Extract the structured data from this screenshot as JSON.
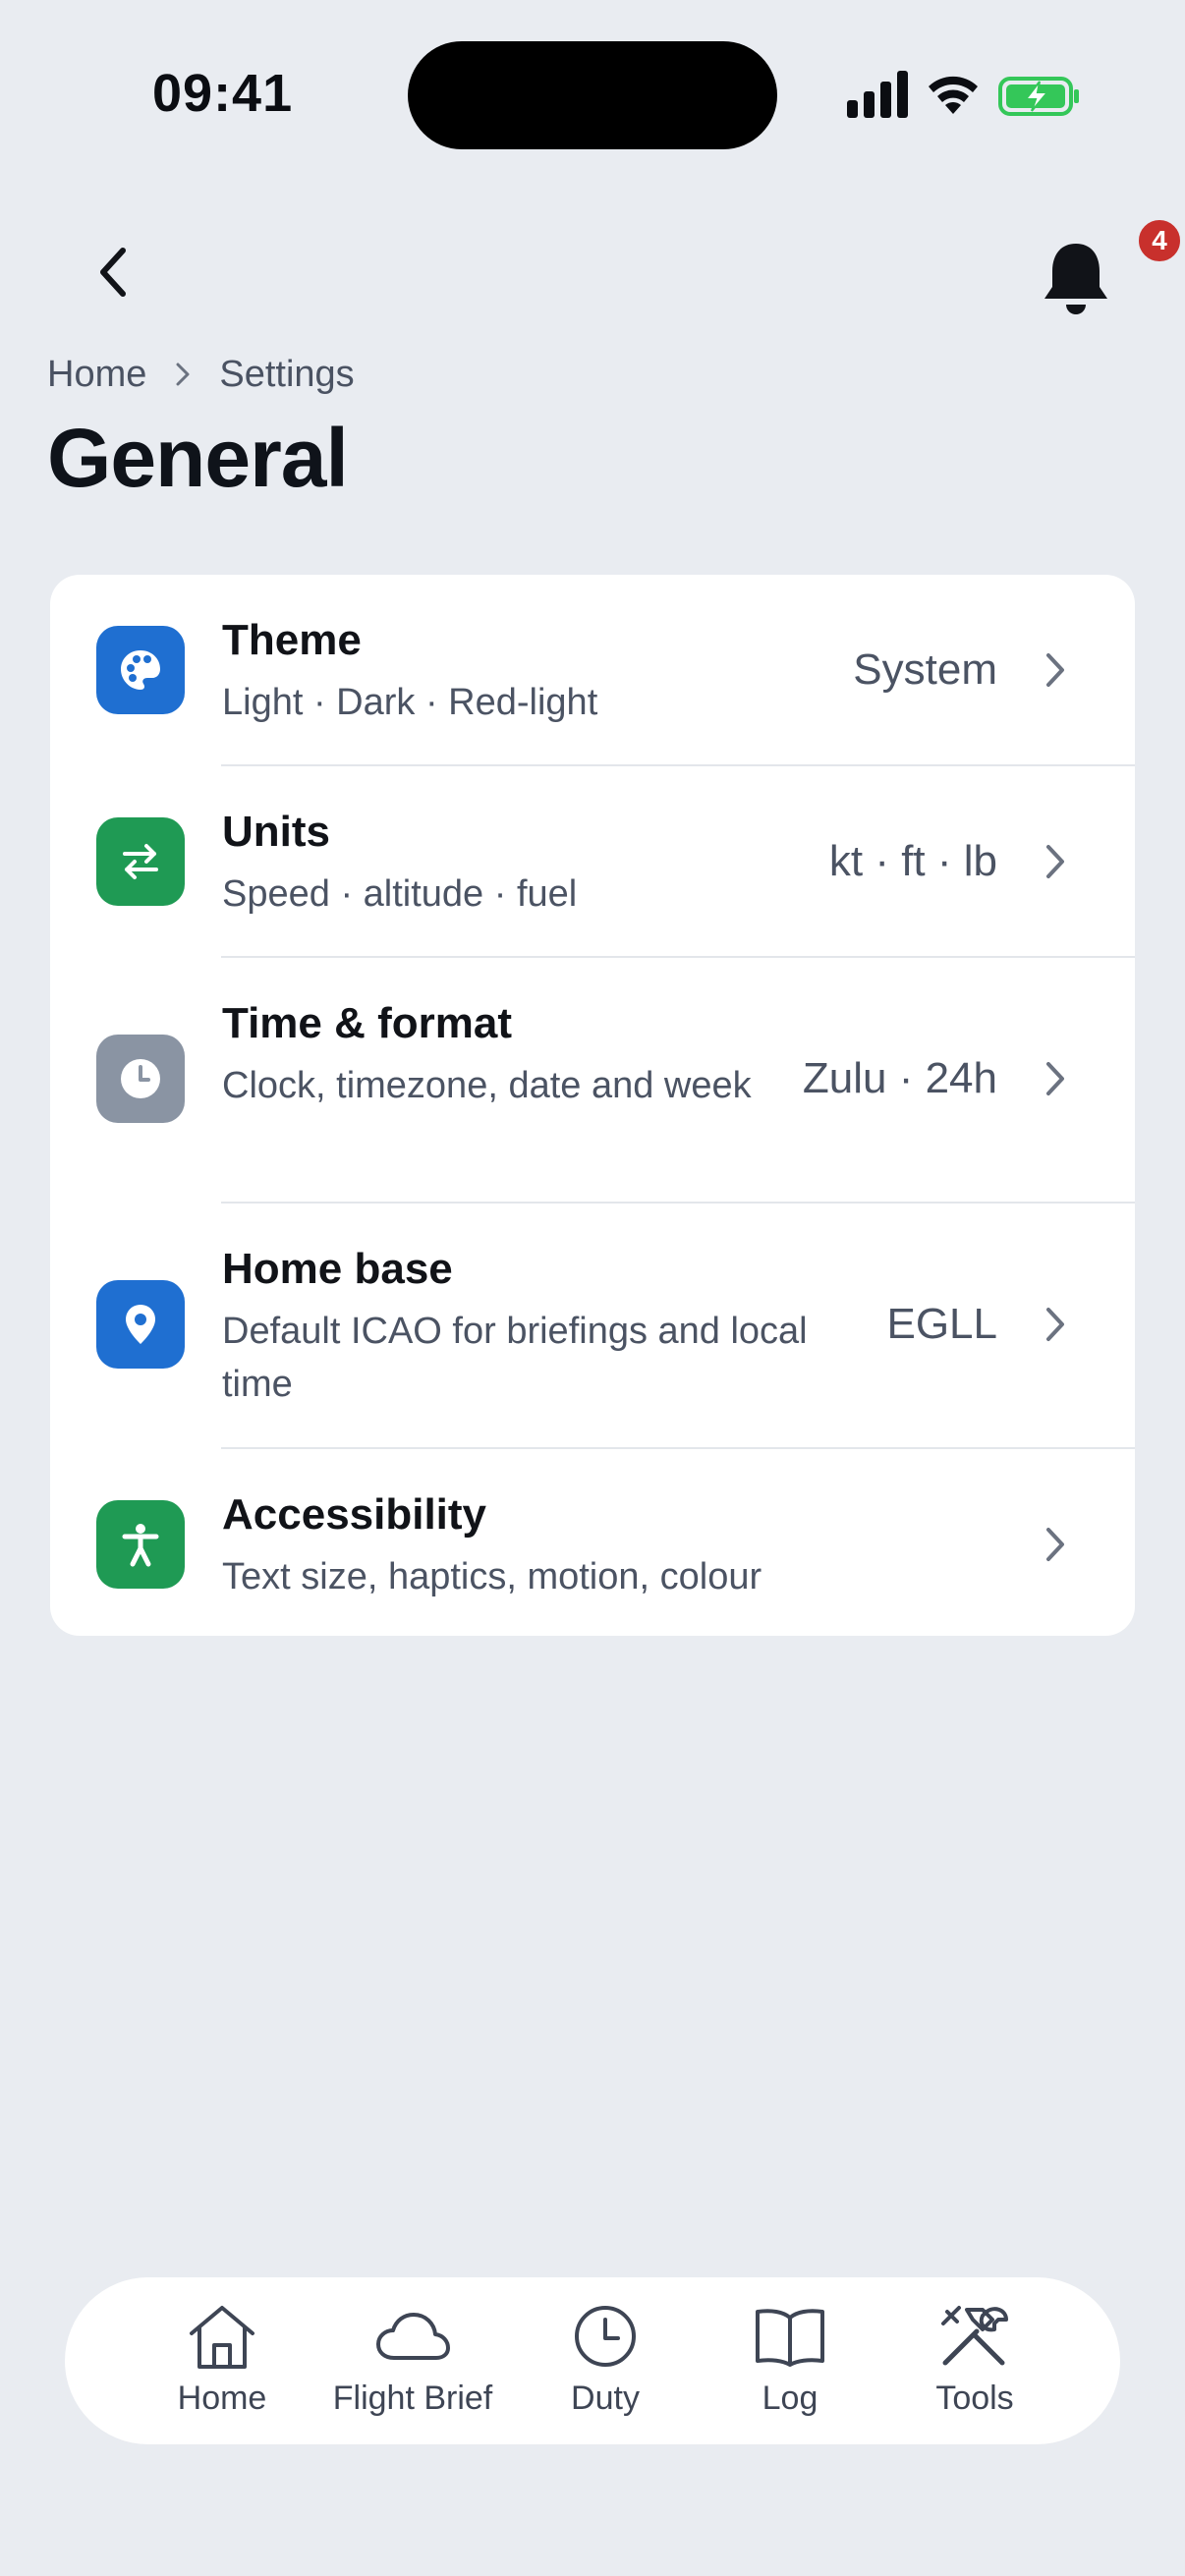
{
  "status_bar": {
    "time": "09:41",
    "icons": [
      "cellular-signal-icon",
      "wifi-icon",
      "battery-charging-icon"
    ]
  },
  "header": {
    "back_icon": "chevron-left-icon",
    "bell_icon": "bell-icon",
    "notification_count": "4"
  },
  "breadcrumb": {
    "items": [
      "Home",
      "Settings"
    ]
  },
  "page": {
    "title": "General"
  },
  "settings": {
    "items": [
      {
        "title": "Theme",
        "subtitle": "Light · Dark · Red-light",
        "value": "System",
        "icon": "palette-icon",
        "icon_color": "#1f6fd1"
      },
      {
        "title": "Units",
        "subtitle": "Speed · altitude · fuel",
        "value": "kt · ft · lb",
        "icon": "swap-arrows-icon",
        "icon_color": "#1f9a54"
      },
      {
        "title": "Time & format",
        "subtitle": "Clock, timezone, date and week",
        "value": "Zulu · 24h",
        "icon": "clock-icon",
        "icon_color": "#8a94a3"
      },
      {
        "title": "Home base",
        "subtitle": "Default ICAO for briefings and local time",
        "value": "EGLL",
        "icon": "location-pin-icon",
        "icon_color": "#1f6fd1"
      },
      {
        "title": "Accessibility",
        "subtitle": "Text size, haptics, motion, colour",
        "value": "",
        "icon": "accessibility-icon",
        "icon_color": "#1f9a54"
      }
    ]
  },
  "bottom_nav": {
    "items": [
      {
        "label": "Home",
        "icon": "house-icon"
      },
      {
        "label": "Flight Brief",
        "icon": "cloud-icon"
      },
      {
        "label": "Duty",
        "icon": "clock-icon"
      },
      {
        "label": "Log",
        "icon": "book-icon"
      },
      {
        "label": "Tools",
        "icon": "tools-icon"
      }
    ]
  },
  "colors": {
    "background": "#e9ecf1",
    "card": "#ffffff",
    "badge": "#c8302c",
    "accent_blue": "#1f6fd1",
    "accent_green": "#1f9a54",
    "battery": "#34c759"
  }
}
